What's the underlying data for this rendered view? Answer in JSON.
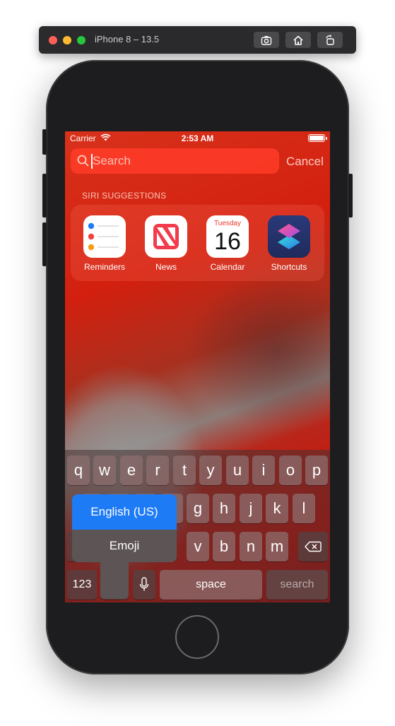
{
  "simulator": {
    "title": "iPhone 8 – 13.5",
    "buttons": [
      "screenshot-icon",
      "home-icon",
      "rotate-icon"
    ]
  },
  "status_bar": {
    "carrier": "Carrier",
    "time": "2:53 AM"
  },
  "search": {
    "placeholder": "Search",
    "cancel_label": "Cancel"
  },
  "siri_suggestions": {
    "header": "SIRI SUGGESTIONS",
    "apps": [
      {
        "label": "Reminders",
        "icon": "reminders-icon"
      },
      {
        "label": "News",
        "icon": "news-icon"
      },
      {
        "label": "Calendar",
        "icon": "calendar-icon",
        "weekday": "Tuesday",
        "day": "16"
      },
      {
        "label": "Shortcuts",
        "icon": "shortcuts-icon"
      }
    ]
  },
  "keyboard": {
    "row1": [
      "q",
      "w",
      "e",
      "r",
      "t",
      "y",
      "u",
      "i",
      "o",
      "p"
    ],
    "row2_visible": [
      "g",
      "h",
      "j",
      "k",
      "l"
    ],
    "row3_visible": [
      "v",
      "b",
      "n",
      "m"
    ],
    "numbers_label": "123",
    "space_label": "space",
    "return_label": "search"
  },
  "language_menu": {
    "selected": "English (US)",
    "other": "Emoji"
  },
  "colors": {
    "selection_blue": "#1e7bf6",
    "accent_red": "#e8392c"
  }
}
